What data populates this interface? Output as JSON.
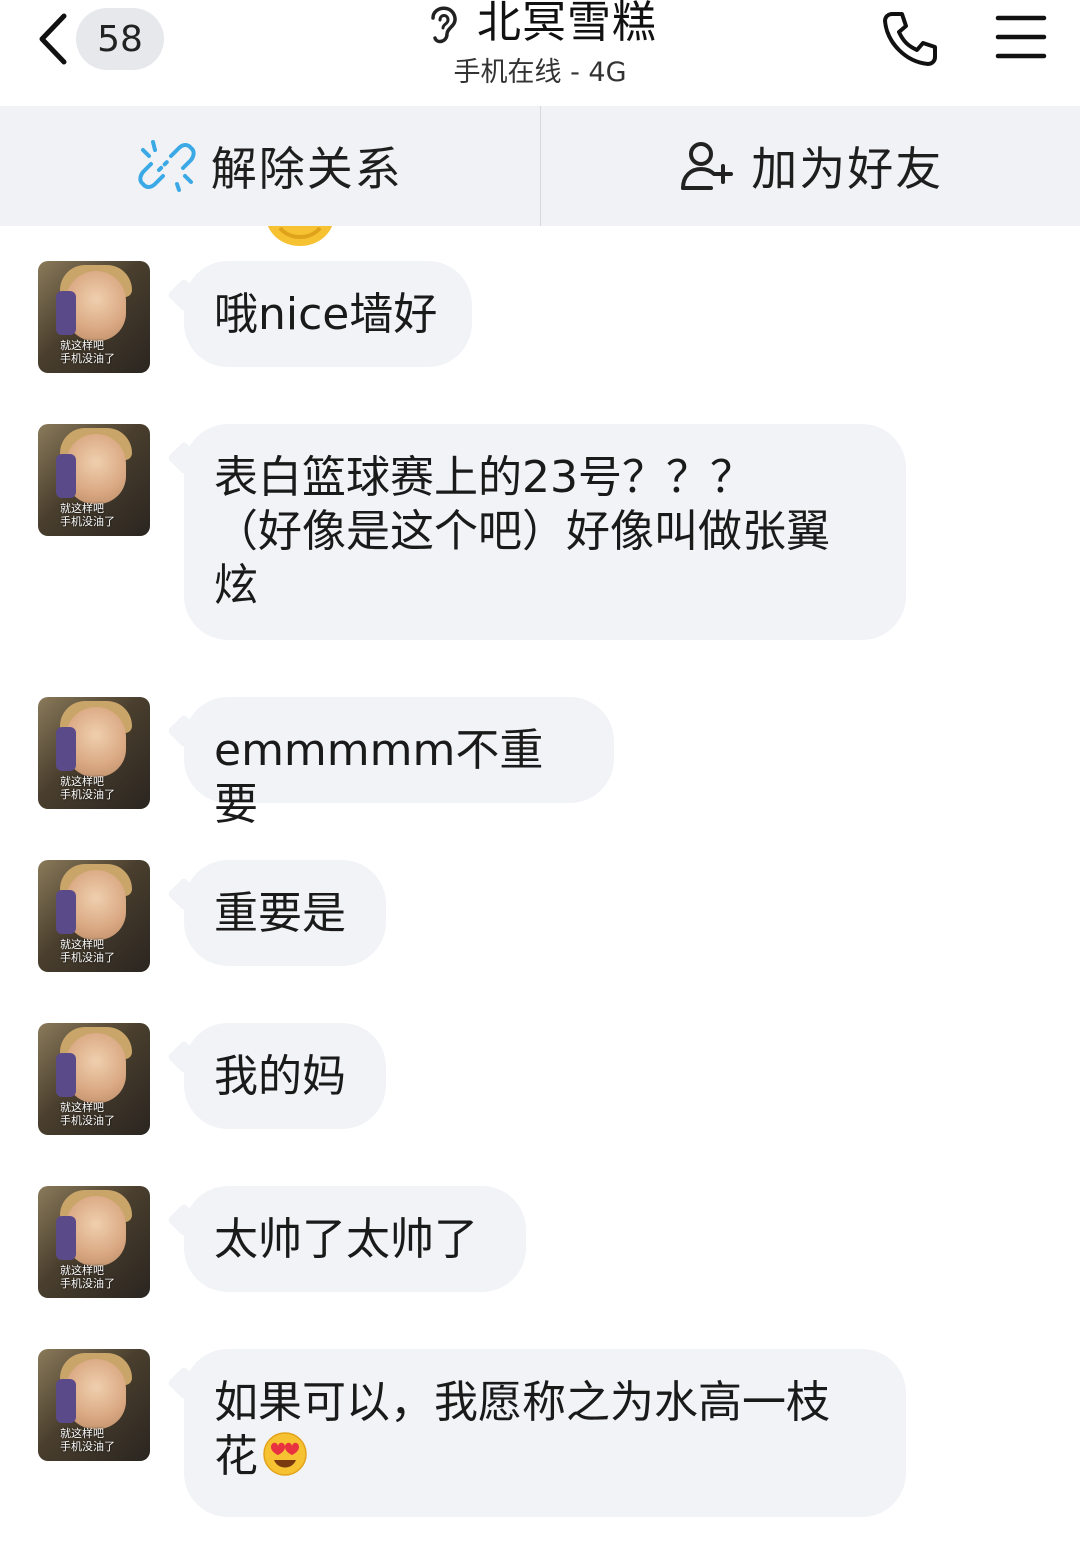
{
  "header": {
    "back_icon": "chevron-left-icon",
    "unread_count": "58",
    "mode_icon": "ear-icon",
    "contact_name": "北冥雪糕",
    "contact_status": "手机在线 - 4G",
    "call_icon": "phone-icon",
    "menu_icon": "menu-icon"
  },
  "actions": {
    "unlink_label": "解除关系",
    "unlink_icon": "broken-link-icon",
    "add_friend_label": "加为好友",
    "add_friend_icon": "add-user-icon"
  },
  "avatar_caption": [
    "就这样吧",
    "手机没油了"
  ],
  "messages": [
    {
      "text": "哦nice墙好"
    },
    {
      "lines": [
        "表白篮球赛上的23号？？？",
        "（好像是这个吧）好像叫做张翼",
        "炫"
      ]
    },
    {
      "text": "emmmmm不重要"
    },
    {
      "text": "重要是"
    },
    {
      "text": "我的妈"
    },
    {
      "text": "太帅了太帅了"
    },
    {
      "lines": [
        "如果可以，我愿称之为水高一枝",
        "花"
      ],
      "trailing_emoji": "heart-eyes-emoji-icon"
    }
  ],
  "colors": {
    "bubble": "#f2f3f7",
    "action_bar": "#f1f2f5",
    "badge": "#e6e8ec",
    "link_icon": "#3aa9e6"
  }
}
